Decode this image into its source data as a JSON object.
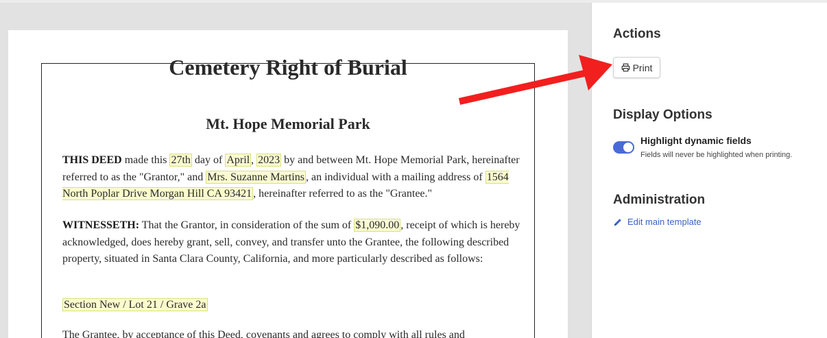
{
  "document": {
    "title": "Cemetery Right of Burial",
    "subtitle": "Mt. Hope Memorial Park",
    "p1": {
      "lead": "THIS DEED",
      "t1": " made this ",
      "day": "27th",
      "t2": " day of ",
      "month": "April",
      "t3": ", ",
      "year": "2023",
      "t4": " by and between Mt. Hope Memorial Park, hereinafter referred to as the \"Grantor,\" and ",
      "grantee": "Mrs. Suzanne Martins",
      "t5": ", an individual with a mailing address of ",
      "address": "1564 North Poplar Drive Morgan Hill CA 93421",
      "t6": ", hereinafter referred to as the \"Grantee.\""
    },
    "p2": {
      "lead": "WITNESSETH:",
      "t1": " That the Grantor, in consideration of the sum of ",
      "amount": "$1,090.00",
      "t2": ", receipt of which is hereby acknowledged, does hereby grant, sell, convey, and transfer unto the Grantee, the following described property, situated in Santa Clara County, California, and more particularly described as follows:"
    },
    "plot": "Section New / Lot 21 / Grave 2a",
    "p4": "The Grantee, by acceptance of this Deed, covenants and agrees to comply with all rules and"
  },
  "sidebar": {
    "actions_heading": "Actions",
    "print_label": "Print",
    "display_heading": "Display Options",
    "highlight_label": "Highlight dynamic fields",
    "highlight_help": "Fields will never be highlighted when printing.",
    "highlight_on": true,
    "admin_heading": "Administration",
    "edit_template_label": "Edit main template"
  },
  "icons": {
    "print": "printer-icon",
    "edit": "pencil-icon"
  },
  "colors": {
    "accent": "#4a6ad6",
    "link": "#3d62c9",
    "field_highlight": "#fbfbd0",
    "annotation_arrow": "#f21f1f"
  }
}
